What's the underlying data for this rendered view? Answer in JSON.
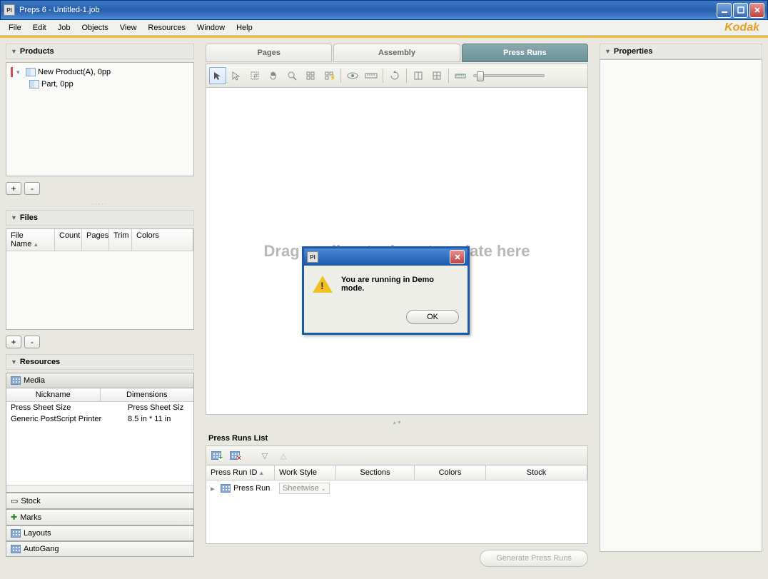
{
  "window": {
    "title": "Preps 6 - Untitled-1.job",
    "app_icon_text": "PI"
  },
  "menu": {
    "items": [
      "File",
      "Edit",
      "Job",
      "Objects",
      "View",
      "Resources",
      "Window",
      "Help"
    ],
    "brand": "Kodak"
  },
  "left": {
    "products": {
      "title": "Products",
      "tree_root": "New Product(A), 0pp",
      "tree_child": "Part, 0pp",
      "add": "+",
      "remove": "-"
    },
    "files": {
      "title": "Files",
      "columns": [
        "File Name",
        "Count",
        "Pages",
        "Trim",
        "Colors"
      ],
      "add": "+",
      "remove": "-"
    },
    "resources": {
      "title": "Resources",
      "tabs": [
        "Media",
        "Stock",
        "Marks",
        "Layouts",
        "AutoGang"
      ],
      "media_columns": [
        "Nickname",
        "Dimensions"
      ],
      "media_rows": [
        {
          "nick": "Press Sheet Size",
          "dim": "Press Sheet Siz"
        },
        {
          "nick": "Generic PostScript Printer",
          "dim": "8.5 in * 11 in"
        }
      ]
    }
  },
  "center": {
    "tabs": [
      "Pages",
      "Assembly",
      "Press Runs"
    ],
    "canvas_hint": "Drag media, stock, or template here",
    "prl": {
      "title": "Press Runs List",
      "columns": [
        "Press Run ID",
        "Work Style",
        "Sections",
        "Colors",
        "Stock"
      ],
      "row_label": "Press Run",
      "row_workstyle": "Sheetwise"
    },
    "generate": "Generate Press Runs"
  },
  "right": {
    "title": "Properties"
  },
  "dialog": {
    "icon_text": "PI",
    "message": "You are running in Demo mode.",
    "ok": "OK"
  }
}
